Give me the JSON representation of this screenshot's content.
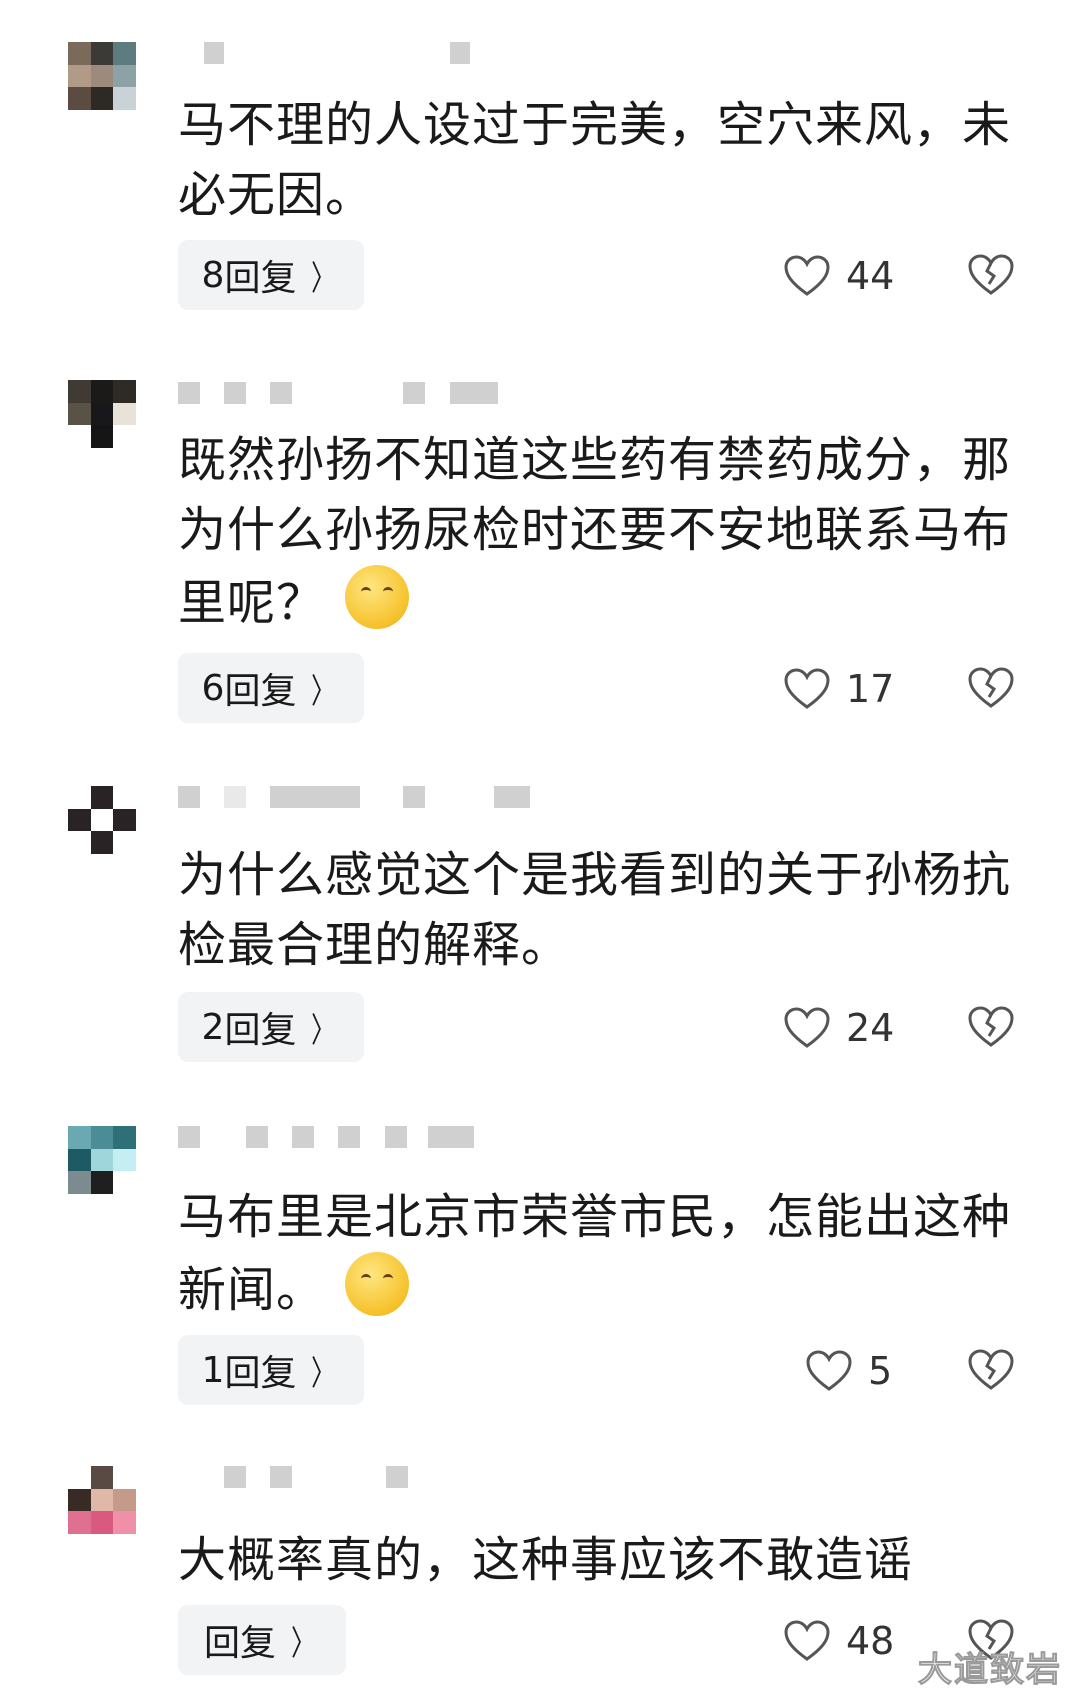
{
  "comments": [
    {
      "text": "马不理的人设过于完美，空穴来风，未必无因。",
      "reply_count": "8",
      "reply_suffix": "回复",
      "likes": "44",
      "emoji": ""
    },
    {
      "text": "既然孙扬不知道这些药有禁药成分，那为什么孙扬尿检时还要不安地联系马布里呢？",
      "reply_count": "6",
      "reply_suffix": "回复",
      "likes": "17",
      "emoji": "thinking-face"
    },
    {
      "text": "为什么感觉这个是我看到的关于孙杨抗检最合理的解释。",
      "reply_count": "2",
      "reply_suffix": "回复",
      "likes": "24",
      "emoji": ""
    },
    {
      "text": "马布里是北京市荣誉市民，怎能出这种新闻。",
      "reply_count": "1",
      "reply_suffix": "回复",
      "likes": "5",
      "emoji": "hand-over-mouth-face"
    },
    {
      "text": "大概率真的，这种事应该不敢造谣",
      "reply_count": "",
      "reply_suffix": "回复",
      "likes": "48",
      "emoji": ""
    }
  ],
  "icons": {
    "like": "heart-outline-icon",
    "dislike": "broken-heart-icon",
    "chevron": "chevron-right-icon"
  },
  "chevron_glyph": "〉",
  "watermark": "大道致岩"
}
